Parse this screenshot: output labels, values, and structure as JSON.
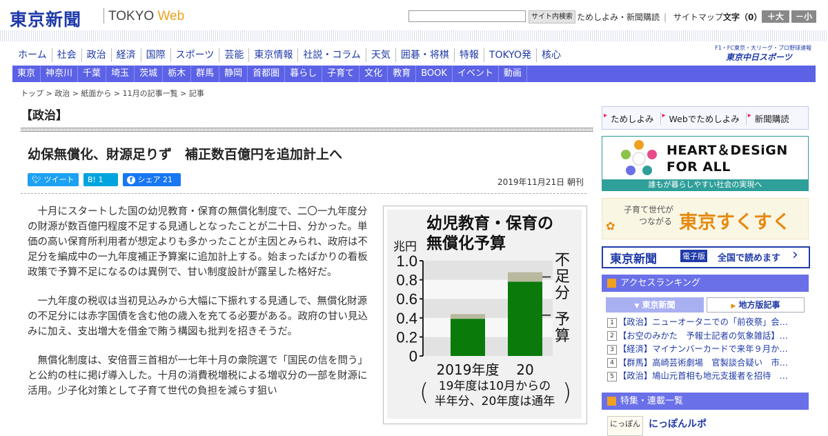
{
  "header": {
    "logo_jp": "東京新聞",
    "logo_en_a": "TOKYO ",
    "logo_en_b": "Web",
    "search_button": "サイト内検索",
    "links": [
      "ためしよみ・新聞購読",
      "サイトマップ"
    ],
    "font_label": "文字（0）",
    "font_large": "＋大",
    "font_small": "－小"
  },
  "main_nav": [
    "ホーム",
    "社会",
    "政治",
    "経済",
    "国際",
    "スポーツ",
    "芸能",
    "東京情報",
    "社説・コラム",
    "天気",
    "囲碁・将棋",
    "特報",
    "TOKYO発",
    "核心"
  ],
  "chunichi": {
    "caption": "F1・FC東京・大リーグ・プロ野球速報",
    "logo": "東京中日スポーツ"
  },
  "sub_nav": [
    "東京",
    "神奈川",
    "千葉",
    "埼玉",
    "茨城",
    "栃木",
    "群馬",
    "静岡",
    "首都圏",
    "暮らし",
    "子育て",
    "文化",
    "教育",
    "BOOK",
    "イベント",
    "動画"
  ],
  "breadcrumb": "トップ > 政治 > 紙面から > 11月の記事一覧 > 記事",
  "section_title": "【政治】",
  "headline": "幼保無償化、財源足りず　補正数百億円を追加計上へ",
  "share": {
    "tweet": "ツイート",
    "hatena": "B! 1",
    "facebook": "シェア 21"
  },
  "dateline": "2019年11月21日 朝刊",
  "article": [
    "十月にスタートした国の幼児教育・保育の無償化制度で、二〇一九年度分の財源が数百億円程度不足する見通しとなったことが二十日、分かった。単価の高い保育所利用者が想定よりも多かったことが主因とみられ、政府は不足分を編成中の一九年度補正予算案に追加計上する。始まったばかりの看板政策で予算不足になるのは異例で、甘い制度設計が露呈した格好だ。",
    "一九年度の税収は当初見込みから大幅に下振れする見通しで、無償化財源の不足分には赤字国債を含む他の歳入を充てる必要がある。政府の甘い見込みに加え、支出増大を借金で賄う構図も批判を招きそうだ。",
    "無償化制度は、安倍晋三首相が一七年十月の衆院選で「国民の信を問う」と公約の柱に掲げ導入した。十月の消費税増税による増収分の一部を財源に活用。少子化対策として子育て世代の負担を減らす狙い"
  ],
  "chart_data": {
    "type": "bar",
    "title_line1": "幼児教育・保育の",
    "title_line2": "無償化予算",
    "ylabel": "兆円",
    "ylim": [
      0,
      1.0
    ],
    "yticks": [
      "0",
      "0.2",
      "0.4",
      "0.6",
      "0.8",
      "1.0"
    ],
    "categories": [
      "2019年度",
      "20"
    ],
    "series": [
      {
        "name": "予算",
        "values": [
          0.39,
          0.78
        ],
        "color": "#0a7a0a"
      },
      {
        "name": "不足分",
        "values": [
          0.05,
          0.1
        ],
        "color": "#b9b9a0"
      }
    ],
    "note_line1": "19年度は10月からの",
    "note_line2": "半年分、20年度は通年"
  },
  "sidebar": {
    "links": [
      "ためしよみ",
      "Webでためしよみ",
      "新聞購読"
    ],
    "hd_text_1": "HEART＆DESiGN",
    "hd_text_2": "FOR ALL",
    "hd_strip": "誰もが暮らしやすい社会の実現へ",
    "sk_small_1": "子育て世代が",
    "sk_small_2": "つながる",
    "sk_big": "東京すくすく",
    "ep_logo": "東京新聞",
    "ep_badge": "電子版",
    "ep_text": "全国で読めます",
    "ranking_title": "アクセスランキング",
    "tab_a": "東京新聞",
    "tab_b": "地方版記事",
    "ranking": [
      "【政治】ニューオータニでの「前夜祭」会…",
      "【お空のみかた　予報士記者の気象雑話】…",
      "【経済】マイナンバーカードで来年９月か…",
      "【群馬】高崎芸術劇場　官製談合疑い　市…",
      "【政治】鳩山元首相も地元支援者を招待　…"
    ],
    "features_title": "特集・連載一覧",
    "feature_thumb": "にっぽん",
    "feature_title": "にっぽんルポ"
  }
}
